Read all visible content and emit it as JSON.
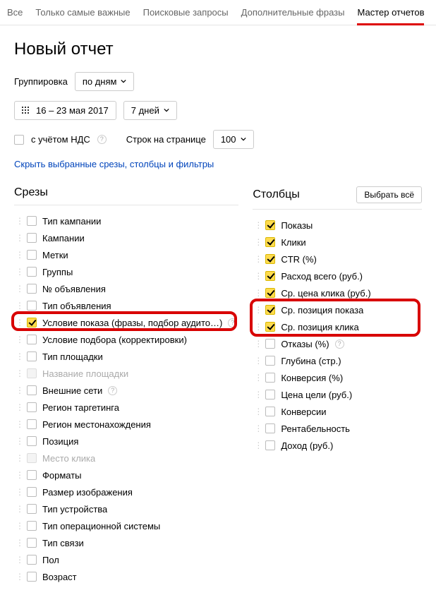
{
  "tabs": {
    "all": "Все",
    "important": "Только самые важные",
    "search": "Поисковые запросы",
    "extra": "Дополнительные фразы",
    "wizard": "Мастер отчетов"
  },
  "title": "Новый отчет",
  "grouping": {
    "label": "Группировка",
    "value": "по дням"
  },
  "date_range": "16 – 23 мая 2017",
  "period": "7 дней",
  "vat": "с учётом НДС",
  "rows_per_page_label": "Строк на странице",
  "rows_per_page_value": "100",
  "hide_link": "Скрыть выбранные срезы, столбцы и фильтры",
  "slices_header": "Срезы",
  "columns_header": "Столбцы",
  "select_all": "Выбрать всё",
  "slices": [
    {
      "label": "Тип кампании",
      "checked": false,
      "help": false
    },
    {
      "label": "Кампании",
      "checked": false,
      "help": false
    },
    {
      "label": "Метки",
      "checked": false,
      "help": false
    },
    {
      "label": "Группы",
      "checked": false,
      "help": false
    },
    {
      "label": "№ объявления",
      "checked": false,
      "help": false
    },
    {
      "label": "Тип объявления",
      "checked": false,
      "help": false
    },
    {
      "label": "Условие показа (фразы, подбор аудито…)",
      "checked": true,
      "help": true,
      "highlight": true
    },
    {
      "label": "Условие подбора (корректировки)",
      "checked": false,
      "help": false
    },
    {
      "label": "Тип площадки",
      "checked": false,
      "help": false
    },
    {
      "label": "Название площадки",
      "checked": false,
      "help": false,
      "disabled": true
    },
    {
      "label": "Внешние сети",
      "checked": false,
      "help": true
    },
    {
      "label": "Регион таргетинга",
      "checked": false,
      "help": false
    },
    {
      "label": "Регион местонахождения",
      "checked": false,
      "help": false
    },
    {
      "label": "Позиция",
      "checked": false,
      "help": false
    },
    {
      "label": "Место клика",
      "checked": false,
      "help": false,
      "disabled": true
    },
    {
      "label": "Форматы",
      "checked": false,
      "help": false
    },
    {
      "label": "Размер изображения",
      "checked": false,
      "help": false
    },
    {
      "label": "Тип устройства",
      "checked": false,
      "help": false
    },
    {
      "label": "Тип операционной системы",
      "checked": false,
      "help": false
    },
    {
      "label": "Тип связи",
      "checked": false,
      "help": false
    },
    {
      "label": "Пол",
      "checked": false,
      "help": false
    },
    {
      "label": "Возраст",
      "checked": false,
      "help": false
    }
  ],
  "columns": [
    {
      "label": "Показы",
      "checked": true,
      "help": false
    },
    {
      "label": "Клики",
      "checked": true,
      "help": false
    },
    {
      "label": "CTR (%)",
      "checked": true,
      "help": false
    },
    {
      "label": "Расход всего (руб.)",
      "checked": true,
      "help": false
    },
    {
      "label": "Ср. цена клика (руб.)",
      "checked": true,
      "help": false
    },
    {
      "label": "Ср. позиция показа",
      "checked": true,
      "help": false,
      "highlight": "start"
    },
    {
      "label": "Ср. позиция клика",
      "checked": true,
      "help": false,
      "highlight": "end"
    },
    {
      "label": "Отказы (%)",
      "checked": false,
      "help": true
    },
    {
      "label": "Глубина (стр.)",
      "checked": false,
      "help": false
    },
    {
      "label": "Конверсия (%)",
      "checked": false,
      "help": false
    },
    {
      "label": "Цена цели (руб.)",
      "checked": false,
      "help": false
    },
    {
      "label": "Конверсии",
      "checked": false,
      "help": false
    },
    {
      "label": "Рентабельность",
      "checked": false,
      "help": false
    },
    {
      "label": "Доход (руб.)",
      "checked": false,
      "help": false
    }
  ]
}
